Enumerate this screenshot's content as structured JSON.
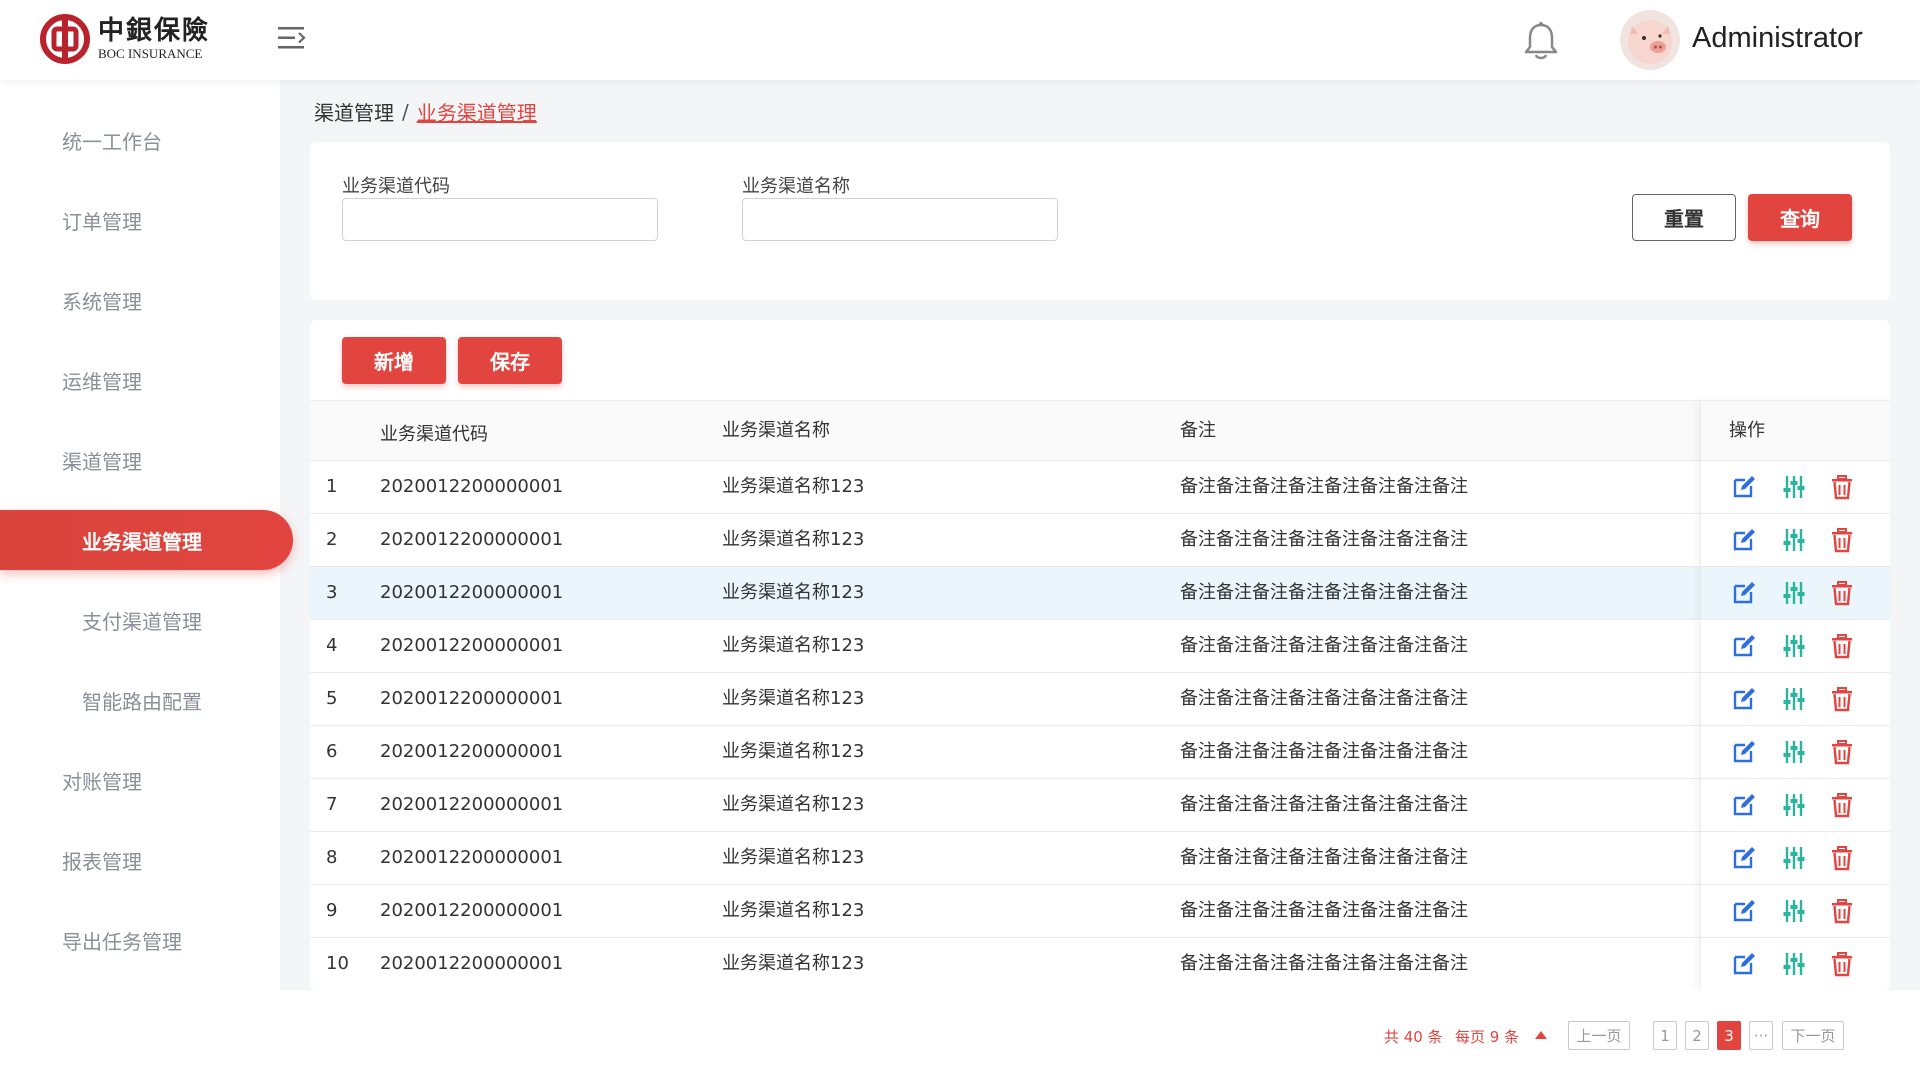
{
  "brand": {
    "cn": "中銀保險",
    "en": "BOC INSURANCE"
  },
  "user": {
    "name": "Administrator"
  },
  "sidebar": {
    "items": [
      {
        "label": "统一工作台",
        "level": 1
      },
      {
        "label": "订单管理",
        "level": 1
      },
      {
        "label": "系统管理",
        "level": 1
      },
      {
        "label": "运维管理",
        "level": 1
      },
      {
        "label": "渠道管理",
        "level": 1
      },
      {
        "label": "业务渠道管理",
        "level": 2,
        "active": true
      },
      {
        "label": "支付渠道管理",
        "level": 2
      },
      {
        "label": "智能路由配置",
        "level": 2
      },
      {
        "label": "对账管理",
        "level": 1
      },
      {
        "label": "报表管理",
        "level": 1
      },
      {
        "label": "导出任务管理",
        "level": 1
      }
    ]
  },
  "breadcrumb": {
    "parent": "渠道管理",
    "separator": "/",
    "current": "业务渠道管理"
  },
  "filter": {
    "code_label": "业务渠道代码",
    "code_value": "",
    "name_label": "业务渠道名称",
    "name_value": "",
    "reset_label": "重置",
    "search_label": "查询"
  },
  "toolbar": {
    "add_label": "新增",
    "save_label": "保存"
  },
  "table": {
    "headers": {
      "code": "业务渠道代码",
      "name": "业务渠道名称",
      "remark": "备注",
      "ops": "操作"
    },
    "highlighted_row": 3,
    "rows": [
      {
        "index": "1",
        "code": "2020012200000001",
        "name": "业务渠道名称123",
        "remark": "备注备注备注备注备注备注备注备注"
      },
      {
        "index": "2",
        "code": "2020012200000001",
        "name": "业务渠道名称123",
        "remark": "备注备注备注备注备注备注备注备注"
      },
      {
        "index": "3",
        "code": "2020012200000001",
        "name": "业务渠道名称123",
        "remark": "备注备注备注备注备注备注备注备注"
      },
      {
        "index": "4",
        "code": "2020012200000001",
        "name": "业务渠道名称123",
        "remark": "备注备注备注备注备注备注备注备注"
      },
      {
        "index": "5",
        "code": "2020012200000001",
        "name": "业务渠道名称123",
        "remark": "备注备注备注备注备注备注备注备注"
      },
      {
        "index": "6",
        "code": "2020012200000001",
        "name": "业务渠道名称123",
        "remark": "备注备注备注备注备注备注备注备注"
      },
      {
        "index": "7",
        "code": "2020012200000001",
        "name": "业务渠道名称123",
        "remark": "备注备注备注备注备注备注备注备注"
      },
      {
        "index": "8",
        "code": "2020012200000001",
        "name": "业务渠道名称123",
        "remark": "备注备注备注备注备注备注备注备注"
      },
      {
        "index": "9",
        "code": "2020012200000001",
        "name": "业务渠道名称123",
        "remark": "备注备注备注备注备注备注备注备注"
      },
      {
        "index": "10",
        "code": "2020012200000001",
        "name": "业务渠道名称123",
        "remark": "备注备注备注备注备注备注备注备注"
      }
    ],
    "row_actions": [
      "edit-icon",
      "sliders-icon",
      "trash-icon"
    ]
  },
  "pagination": {
    "total_text": "共 40 条",
    "page_size_text": "每页 9 条",
    "prev_label": "上一页",
    "next_label": "下一页",
    "pages": [
      "1",
      "2",
      "3"
    ],
    "current_page": "3",
    "ellipsis": "···"
  },
  "colors": {
    "accent": "#e2443f",
    "icon_edit": "#2f6fdc",
    "icon_sliders": "#2bb5a0",
    "icon_trash": "#e2443f",
    "row_highlight": "#eaf6fb"
  }
}
